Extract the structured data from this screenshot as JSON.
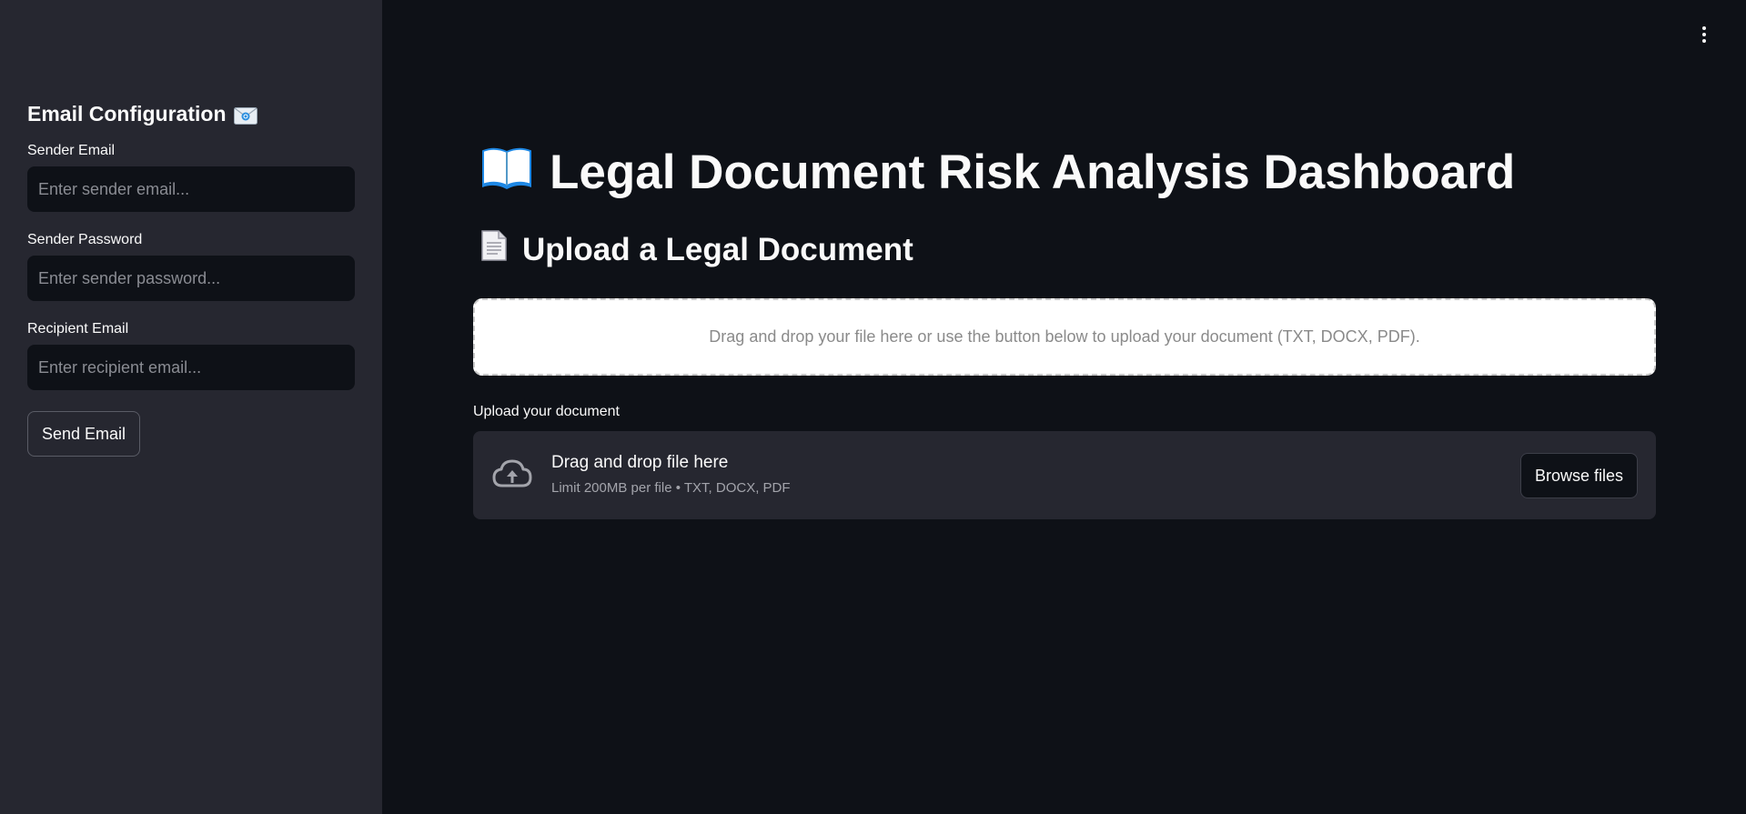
{
  "sidebar": {
    "title": "Email Configuration",
    "title_icon": "envelope-icon",
    "sender_email": {
      "label": "Sender Email",
      "placeholder": "Enter sender email...",
      "value": ""
    },
    "sender_password": {
      "label": "Sender Password",
      "placeholder": "Enter sender password...",
      "value": ""
    },
    "recipient_email": {
      "label": "Recipient Email",
      "placeholder": "Enter recipient email...",
      "value": ""
    },
    "send_button_label": "Send Email"
  },
  "header": {
    "menu_icon": "kebab-menu-icon"
  },
  "main": {
    "title": "Legal Document Risk Analysis Dashboard",
    "title_icon": "open-book-icon",
    "section_title": "Upload a Legal Document",
    "section_icon": "document-icon",
    "dropzone_info": "Drag and drop your file here or use the button below to upload your document (TXT, DOCX, PDF).",
    "uploader": {
      "label": "Upload your document",
      "icon": "cloud-upload-icon",
      "title": "Drag and drop file here",
      "subtitle": "Limit 200MB per file • TXT, DOCX, PDF",
      "browse_label": "Browse files"
    }
  },
  "colors": {
    "background": "#0e1117",
    "sidebar_background": "#262730",
    "text": "#fafafa",
    "muted_text": "#a3a4ab",
    "dropzone_background": "#ffffff"
  }
}
